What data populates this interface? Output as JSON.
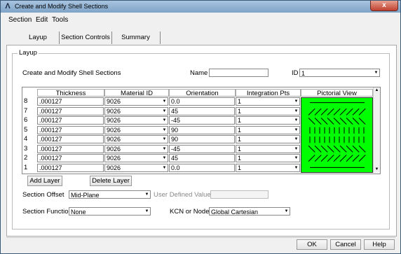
{
  "window": {
    "title": "Create and Modify Shell Sections",
    "close_glyph": "x"
  },
  "menu": {
    "items": [
      "Section",
      "Edit",
      "Tools"
    ]
  },
  "tabs": [
    {
      "label": "Layup"
    },
    {
      "label": "Section Controls"
    },
    {
      "label": "Summary"
    }
  ],
  "group": {
    "label": "Layup",
    "heading": "Create and Modify Shell Sections"
  },
  "name_field": {
    "label": "Name",
    "value": ""
  },
  "id_field": {
    "label": "ID",
    "value": "1"
  },
  "table": {
    "headers": [
      "Thickness",
      "Material ID",
      "Orientation",
      "Integration Pts",
      "Pictorial View"
    ],
    "rows": [
      {
        "num": "8",
        "thickness": ".000127",
        "material": "9026",
        "orientation": "0.0",
        "int_pts": "1"
      },
      {
        "num": "7",
        "thickness": ".000127",
        "material": "9026",
        "orientation": "45",
        "int_pts": "1"
      },
      {
        "num": "6",
        "thickness": ".000127",
        "material": "9026",
        "orientation": "-45",
        "int_pts": "1"
      },
      {
        "num": "5",
        "thickness": ".000127",
        "material": "9026",
        "orientation": "90",
        "int_pts": "1"
      },
      {
        "num": "4",
        "thickness": ".000127",
        "material": "9026",
        "orientation": "90",
        "int_pts": "1"
      },
      {
        "num": "3",
        "thickness": ".000127",
        "material": "9026",
        "orientation": "-45",
        "int_pts": "1"
      },
      {
        "num": "2",
        "thickness": ".000127",
        "material": "9026",
        "orientation": "45",
        "int_pts": "1"
      },
      {
        "num": "1",
        "thickness": ".000127",
        "material": "9026",
        "orientation": "0.0",
        "int_pts": "1"
      }
    ],
    "pictorial_color": "#00ff00"
  },
  "buttons": {
    "add_layer": "Add Layer",
    "delete_layer": "Delete Layer",
    "ok": "OK",
    "cancel": "Cancel",
    "help": "Help"
  },
  "section_offset": {
    "label": "Section Offset",
    "value": "Mid-Plane",
    "user_defined_label": "User Defined Value",
    "user_defined_value": ""
  },
  "section_function": {
    "label": "Section Function",
    "value": "None"
  },
  "kcn": {
    "label": "KCN or Node",
    "value": "Global Cartesian"
  }
}
